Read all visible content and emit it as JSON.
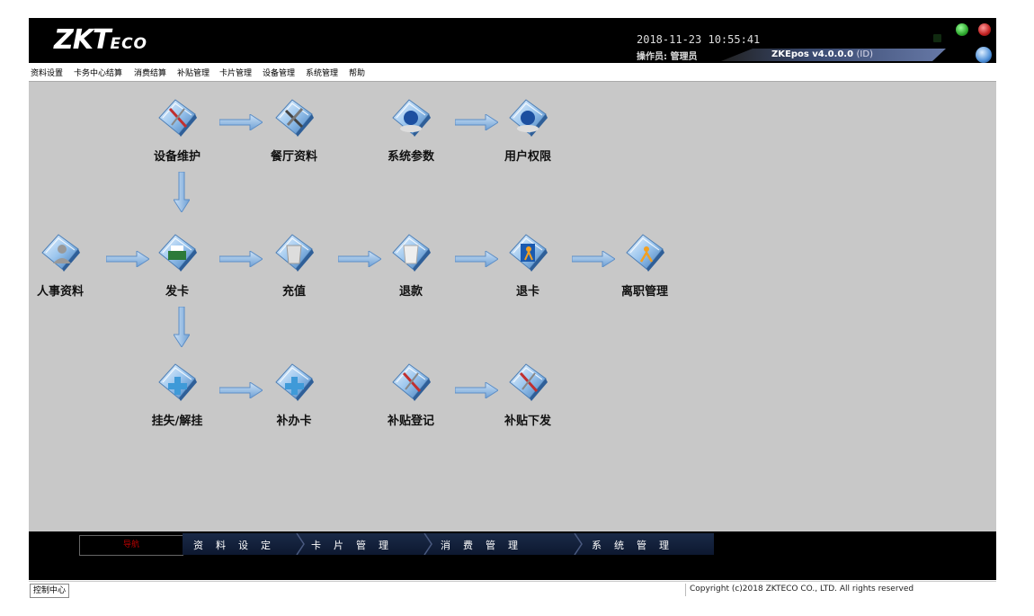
{
  "header": {
    "logo_main": "ZKT",
    "logo_eco": "ECO",
    "datetime": "2018-11-23 10:55:41",
    "operator": "操作员: 管理员",
    "version": "ZKEpos v4.0.0.0",
    "version_id": "(ID)"
  },
  "menu": [
    "资料设置",
    "卡务中心结算",
    "消费结算",
    "补贴管理",
    "卡片管理",
    "设备管理",
    "系统管理",
    "帮助"
  ],
  "tiles": {
    "device_maintenance": "设备维护",
    "restaurant_info": "餐厅资料",
    "system_params": "系统参数",
    "user_permissions": "用户权限",
    "personnel": "人事资料",
    "issue_card": "发卡",
    "recharge": "充值",
    "refund": "退款",
    "return_card": "退卡",
    "resignation": "离职管理",
    "report_loss": "挂失/解挂",
    "reissue_card": "补办卡",
    "subsidy_register": "补贴登记",
    "subsidy_issue": "补贴下发"
  },
  "nav": {
    "guide": "导航",
    "segments": [
      "资料设定",
      "卡片管理",
      "消费管理",
      "系统管理"
    ]
  },
  "status": {
    "tab": "控制中心",
    "copyright": "Copyright (c)2018 ZKTECO CO., LTD. All rights reserved"
  },
  "colors": {
    "background": "#c8c8c8",
    "header": "#000000",
    "accent_blue": "#6aa0d8",
    "status_green": "#2ea82e",
    "status_red": "#c02020"
  }
}
